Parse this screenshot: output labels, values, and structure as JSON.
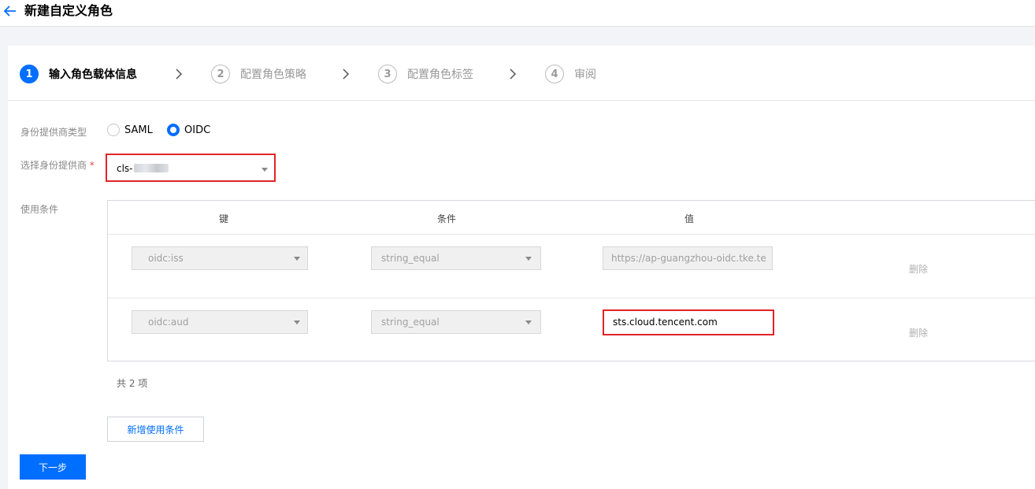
{
  "header": {
    "title": "新建自定义角色"
  },
  "steps": [
    {
      "num": "1",
      "label": "输入角色载体信息"
    },
    {
      "num": "2",
      "label": "配置角色策略"
    },
    {
      "num": "3",
      "label": "配置角色标签"
    },
    {
      "num": "4",
      "label": "审阅"
    }
  ],
  "form": {
    "provider_type_label": "身份提供商类型",
    "provider_type_options": [
      "SAML",
      "OIDC"
    ],
    "provider_label": "选择身份提供商",
    "required_mark": "*",
    "provider_value": "cls-",
    "conditions_label": "使用条件"
  },
  "table": {
    "headers": [
      "键",
      "条件",
      "值"
    ],
    "rows": [
      {
        "key": "oidc:iss",
        "condition": "string_equal",
        "value": "https://ap-guangzhou-oidc.tke.te",
        "action": "删除"
      },
      {
        "key": "oidc:aud",
        "condition": "string_equal",
        "value": "sts.cloud.tencent.com",
        "action": "删除"
      }
    ],
    "count": "共 2 项"
  },
  "buttons": {
    "add_condition": "新增使用条件",
    "next": "下一步"
  },
  "colors": {
    "primary": "#006eff",
    "highlight": "#e02424"
  }
}
